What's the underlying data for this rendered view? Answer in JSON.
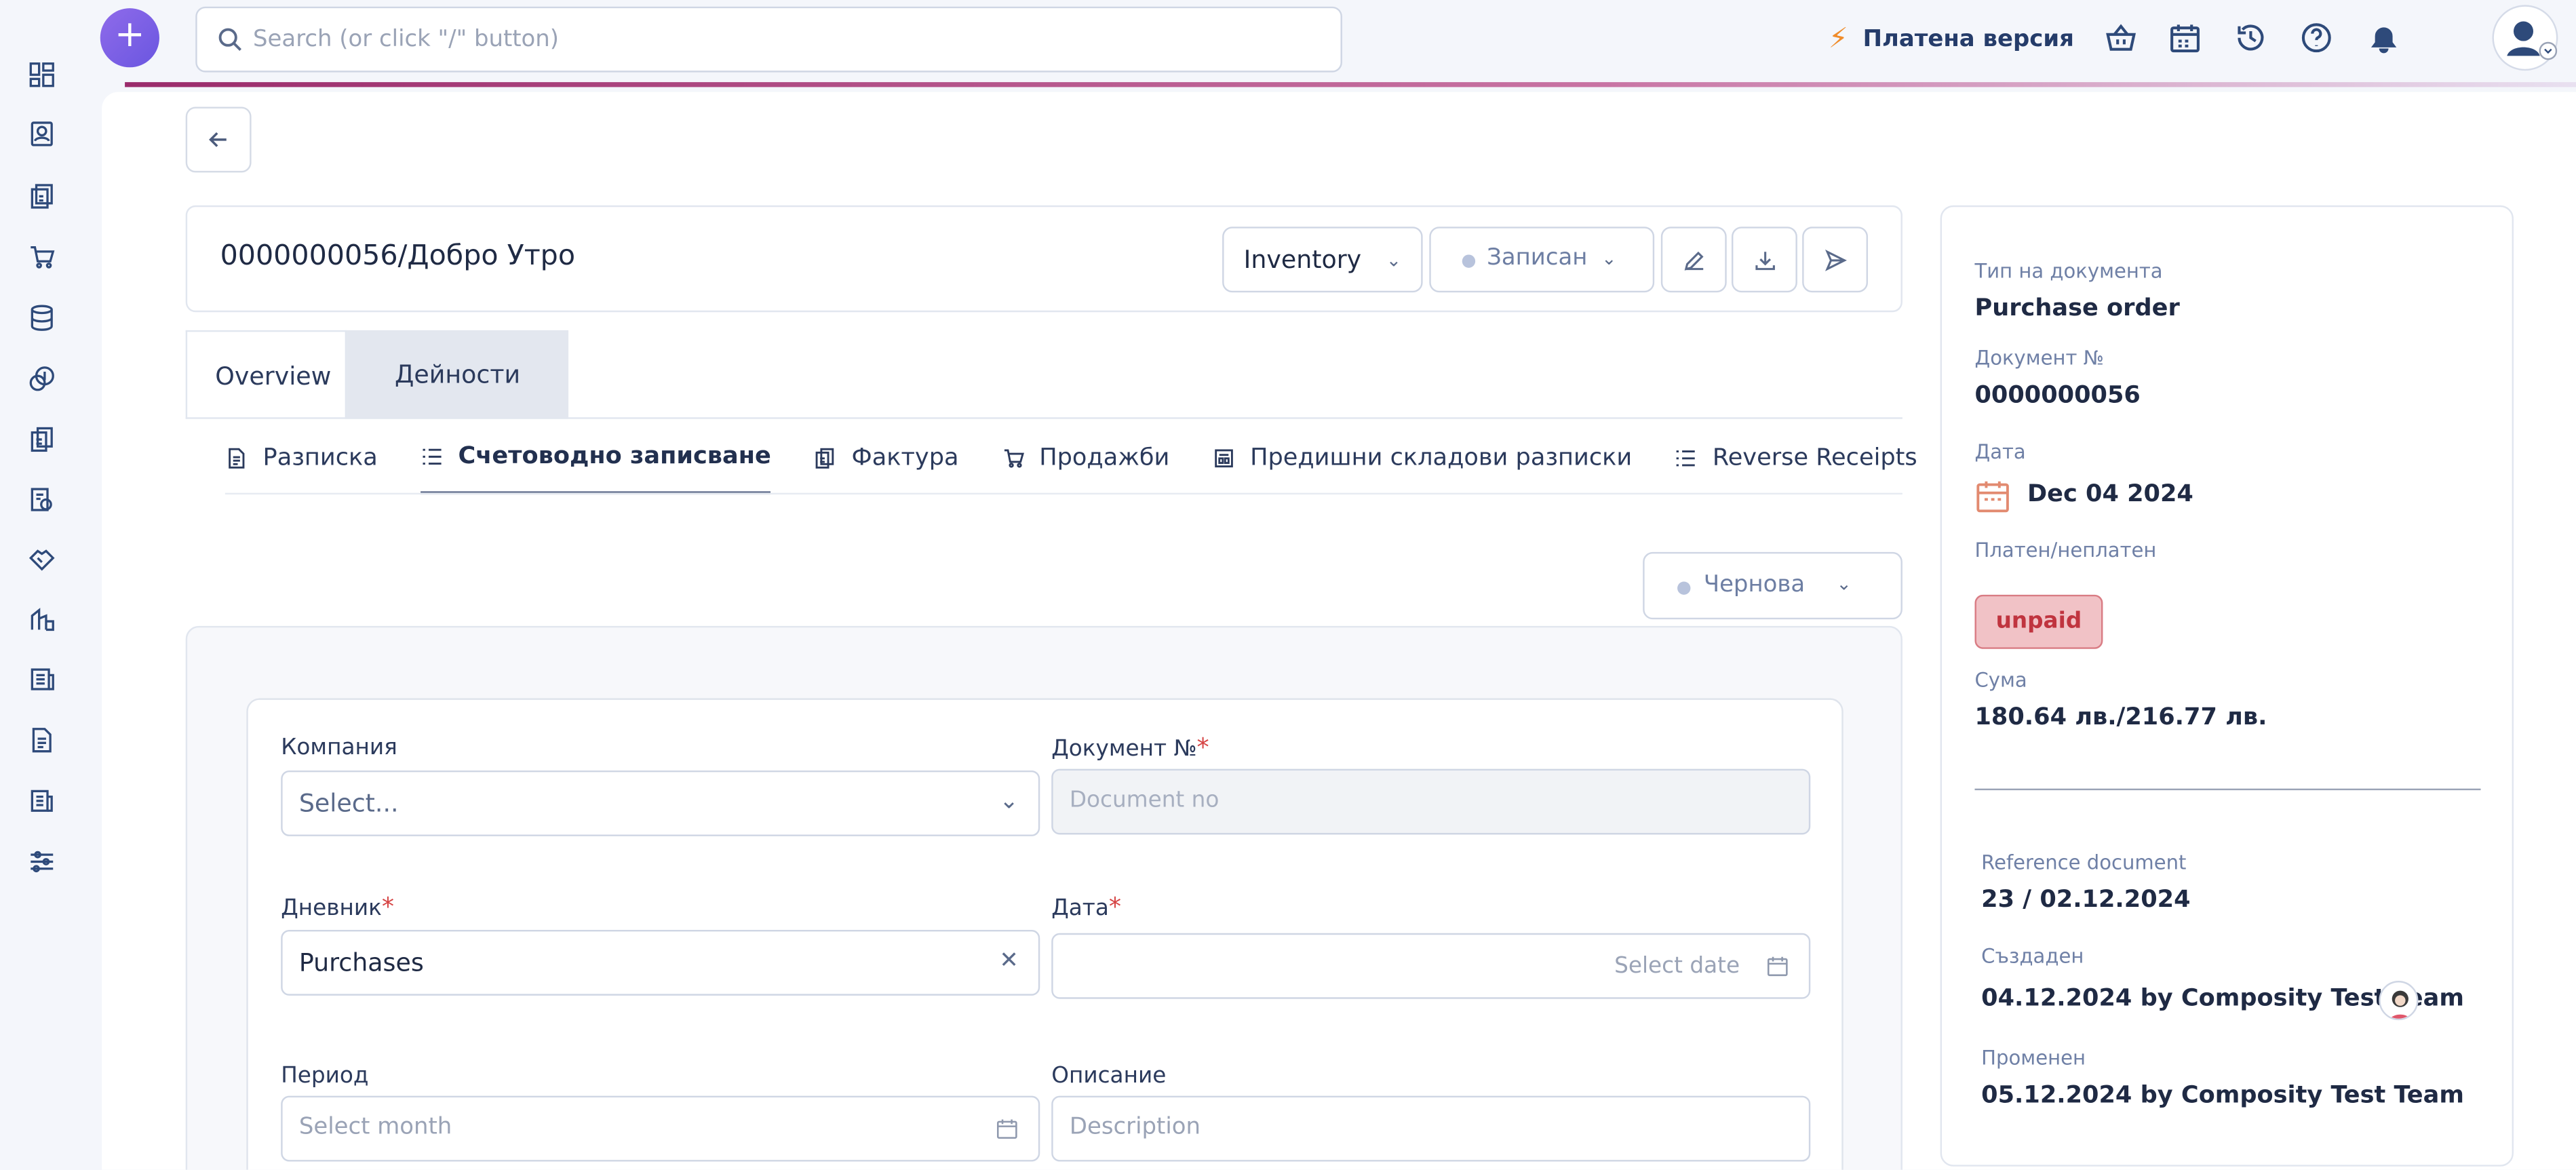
{
  "topbar": {
    "search_placeholder": "Search (or click \"/\" button)",
    "paid_label": "Платена версия",
    "plus_label": "+"
  },
  "header": {
    "doc_title": "0000000056/Добро Утро",
    "inventory_label": "Inventory",
    "status_label": "Записан"
  },
  "tabs": {
    "overview": "Overview",
    "actions": "Дейности"
  },
  "subtabs": {
    "receipt": "Разписка",
    "accounting": "Счетоводно записване",
    "invoice": "Фактура",
    "sales": "Продажби",
    "previous_receipts": "Предишни складови разписки",
    "reverse_receipts": "Reverse Receipts"
  },
  "draft_status": "Чернова",
  "form": {
    "company_label": "Компания",
    "company_value": "Select...",
    "docno_label": "Документ №",
    "docno_placeholder": "Document no",
    "journal_label": "Дневник",
    "journal_value": "Purchases",
    "date_label": "Дата",
    "date_placeholder": "Select date",
    "period_label": "Период",
    "period_placeholder": "Select month",
    "description_label": "Описание",
    "description_placeholder": "Description",
    "required_mark": "*"
  },
  "side": {
    "doc_type_label": "Тип на документа",
    "doc_type_value": "Purchase order",
    "doc_no_label": "Документ №",
    "doc_no_value": "0000000056",
    "date_label": "Дата",
    "date_value": "Dec 04 2024",
    "paid_label": "Платен/неплатен",
    "paid_badge": "unpaid",
    "sum_label": "Сума",
    "sum_value": "180.64 лв./216.77 лв.",
    "ref_label": "Reference document",
    "ref_value": "23 / 02.12.2024",
    "created_label": "Създаден",
    "created_value": "04.12.2024 by Composity Test Team",
    "modified_label": "Променен",
    "modified_value": "05.12.2024 by Composity Test Team"
  },
  "colors": {
    "accent": "#6a56e0",
    "unpaid_bg": "#f1c2c6",
    "unpaid_text": "#c0343f",
    "bolt": "#f08c2a"
  }
}
